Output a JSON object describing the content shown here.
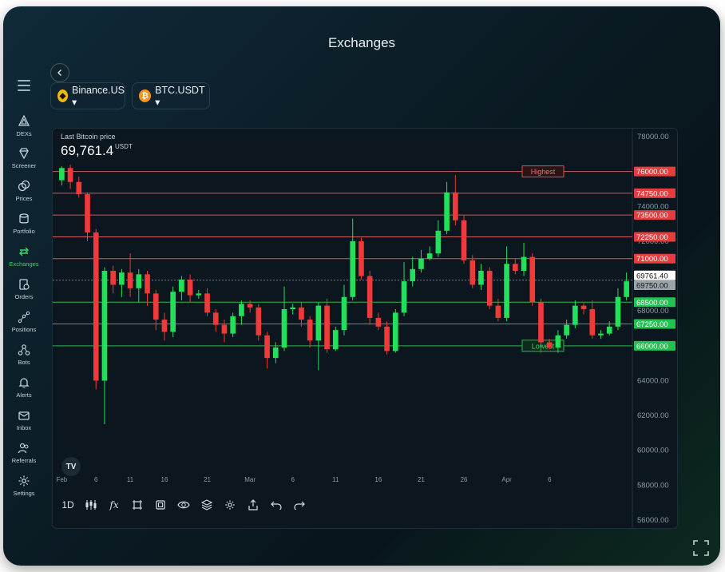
{
  "window": {
    "title": "Exchanges"
  },
  "sidebar": {
    "items": [
      {
        "label": "DEXs",
        "icon": "dex-icon"
      },
      {
        "label": "Screener",
        "icon": "diamond-icon"
      },
      {
        "label": "Prices",
        "icon": "coins-icon"
      },
      {
        "label": "Portfolio",
        "icon": "database-icon"
      },
      {
        "label": "Exchanges",
        "icon": "exchange-arrows-icon",
        "active": true
      },
      {
        "label": "Orders",
        "icon": "orders-icon"
      },
      {
        "label": "Positions",
        "icon": "positions-icon"
      },
      {
        "label": "Bots",
        "icon": "bots-icon"
      },
      {
        "label": "Alerts",
        "icon": "bell-icon"
      },
      {
        "label": "Inbox",
        "icon": "mail-icon"
      },
      {
        "label": "Referrals",
        "icon": "users-icon"
      },
      {
        "label": "Settings",
        "icon": "gear-icon"
      }
    ]
  },
  "selectors": {
    "exchange": "Binance.US ▾",
    "pair": "BTC.USDT ▾"
  },
  "price": {
    "label": "Last Bitcoin price",
    "value": "69,761.4",
    "unit": "USDT"
  },
  "colors": {
    "up": "#22e05a",
    "down": "#ef3a3a",
    "accent": "#38d66b",
    "background": "#0b161e"
  },
  "chart_data": {
    "type": "candlestick",
    "ylim": [
      56000,
      78000
    ],
    "y_ticks": [
      "56000.00",
      "58000.00",
      "60000.00",
      "62000.00",
      "64000.00",
      "66000.00",
      "68000.00",
      "70000.00",
      "72000.00",
      "74000.00",
      "76000.00",
      "78000.00"
    ],
    "x_ticks": [
      "Feb",
      "6",
      "11",
      "16",
      "21",
      "Mar",
      "6",
      "11",
      "16",
      "21",
      "26",
      "Apr",
      "6"
    ],
    "x_tick_index": [
      0,
      4,
      8,
      12,
      17,
      22,
      27,
      32,
      37,
      42,
      47,
      52,
      57
    ],
    "levels": [
      {
        "value": 76000,
        "label": "76000.00",
        "kind": "resistance"
      },
      {
        "value": 74750,
        "label": "74750.00",
        "kind": "resistance"
      },
      {
        "value": 73500,
        "label": "73500.00",
        "kind": "resistance"
      },
      {
        "value": 72250,
        "label": "72250.00",
        "kind": "resistance"
      },
      {
        "value": 71000,
        "label": "71000.00",
        "kind": "resistance"
      },
      {
        "value": 68500,
        "label": "68500.00",
        "kind": "support"
      },
      {
        "value": 67250,
        "label": "67250.00",
        "kind": "support"
      },
      {
        "value": 66000,
        "label": "66000.00",
        "kind": "support"
      }
    ],
    "price_tags": [
      {
        "value": 69761.4,
        "label": "69761.40",
        "kind": "current"
      },
      {
        "value": 69750.0,
        "label": "69750.00",
        "kind": "prev"
      }
    ],
    "annotations": [
      {
        "text": "Highest",
        "level": 76000,
        "kind": "resistance"
      },
      {
        "text": "Lowest",
        "level": 66000,
        "kind": "support"
      }
    ],
    "candles": [
      [
        75500,
        76200,
        75200,
        76300
      ],
      [
        76200,
        75400,
        75000,
        76400
      ],
      [
        75400,
        74700,
        74500,
        75700
      ],
      [
        74700,
        72500,
        72000,
        74800
      ],
      [
        72500,
        64000,
        63500,
        72700
      ],
      [
        64000,
        70300,
        61500,
        70500
      ],
      [
        70300,
        69500,
        69000,
        70600
      ],
      [
        69500,
        70200,
        68800,
        70400
      ],
      [
        70200,
        69300,
        68800,
        71300
      ],
      [
        69300,
        70100,
        68500,
        70400
      ],
      [
        70100,
        69000,
        68300,
        70300
      ],
      [
        69000,
        67500,
        66900,
        69200
      ],
      [
        67500,
        66800,
        66300,
        67900
      ],
      [
        66800,
        69100,
        66500,
        69400
      ],
      [
        69100,
        69800,
        68600,
        70000
      ],
      [
        69800,
        68900,
        68500,
        70100
      ],
      [
        68900,
        69000,
        68700,
        69200
      ],
      [
        69000,
        67900,
        67700,
        69300
      ],
      [
        67900,
        67200,
        66800,
        68100
      ],
      [
        67200,
        66700,
        66200,
        67500
      ],
      [
        66700,
        67700,
        66500,
        67900
      ],
      [
        67700,
        68400,
        67200,
        68600
      ],
      [
        68400,
        68200,
        67900,
        68600
      ],
      [
        68200,
        66600,
        66300,
        68400
      ],
      [
        66600,
        65300,
        64700,
        66800
      ],
      [
        65300,
        65900,
        65000,
        66200
      ],
      [
        65900,
        68100,
        65700,
        69400
      ],
      [
        68100,
        68200,
        67800,
        68400
      ],
      [
        68200,
        67500,
        67100,
        68500
      ],
      [
        67500,
        66300,
        65900,
        67700
      ],
      [
        66300,
        68300,
        64600,
        68500
      ],
      [
        68300,
        65800,
        65600,
        68700
      ],
      [
        65800,
        66900,
        65700,
        67100
      ],
      [
        66900,
        68800,
        66600,
        69500
      ],
      [
        68800,
        72000,
        68600,
        73300
      ],
      [
        72000,
        70000,
        69800,
        72200
      ],
      [
        70000,
        67600,
        67200,
        70300
      ],
      [
        67600,
        67100,
        66900,
        67900
      ],
      [
        67100,
        65700,
        65500,
        67400
      ],
      [
        65700,
        67900,
        65600,
        68100
      ],
      [
        67900,
        69700,
        67700,
        70800
      ],
      [
        69700,
        70400,
        69400,
        71100
      ],
      [
        70400,
        71000,
        70200,
        71500
      ],
      [
        71000,
        71300,
        70900,
        71700
      ],
      [
        71300,
        72600,
        71100,
        73200
      ],
      [
        72600,
        74800,
        72400,
        75400
      ],
      [
        74800,
        73200,
        72900,
        75800
      ],
      [
        73200,
        70900,
        70700,
        73500
      ],
      [
        70900,
        69500,
        69300,
        71200
      ],
      [
        69500,
        70300,
        69200,
        70700
      ],
      [
        70300,
        68300,
        68100,
        70500
      ],
      [
        68300,
        67600,
        67400,
        68700
      ],
      [
        67600,
        70700,
        67400,
        71700
      ],
      [
        70700,
        70300,
        70100,
        71000
      ],
      [
        70300,
        71100,
        70000,
        71900
      ],
      [
        71100,
        68500,
        68300,
        71300
      ],
      [
        68500,
        66200,
        65600,
        68700
      ],
      [
        66200,
        65900,
        65800,
        66400
      ],
      [
        65900,
        66600,
        65600,
        66900
      ],
      [
        66600,
        67200,
        66400,
        67500
      ],
      [
        67200,
        68300,
        67000,
        68600
      ],
      [
        68300,
        68100,
        67800,
        68500
      ],
      [
        68100,
        66600,
        66400,
        68600
      ],
      [
        66600,
        66700,
        66400,
        66900
      ],
      [
        66700,
        67100,
        66600,
        67400
      ],
      [
        67100,
        68800,
        66900,
        69300
      ],
      [
        68800,
        69700,
        68600,
        70200
      ]
    ]
  }
}
